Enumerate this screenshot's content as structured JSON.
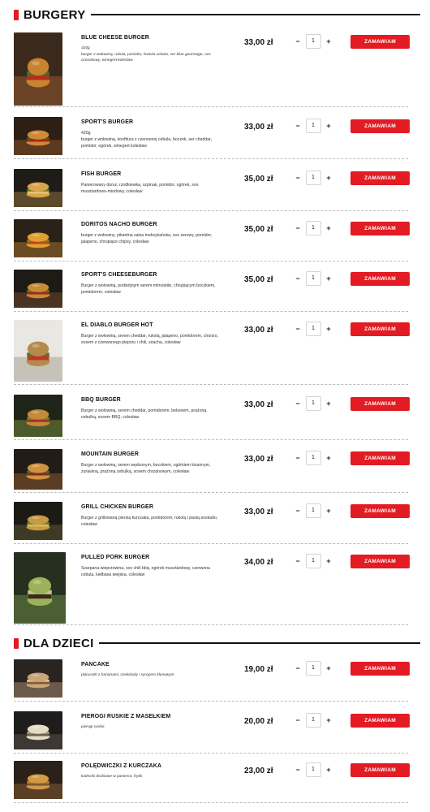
{
  "sections": [
    {
      "title": "BURGERY",
      "items": [
        {
          "name": "BLUE CHEESE BURGER",
          "desc": "420g\nburger z wołowiną, rukola, pomidor, świeża cebula, ser blue gourmage, sos czosnkowy, winegret kolesław",
          "price": "33,00 zł",
          "qty": "1"
        },
        {
          "name": "SPORT'S BURGER",
          "desc": "420g\nburger z wołowiną, konfitura z czerwonej cebula, boczek, ser cheddar, pomidor, ogórek, winegret kolesław",
          "price": "33,00 zł",
          "qty": "1"
        },
        {
          "name": "FISH BURGER",
          "desc": "Panierowany dorsz, rzodkiewka, szpinak, pomidor, ogórek, sos musztardowo-miodowy, colesław",
          "price": "35,00 zł",
          "qty": "1"
        },
        {
          "name": "DORITOS NACHO BURGER",
          "desc": "burger z wołowiny, pikantna salsa meksykańska, sos serowy, pomidor, jalapeno, chrupiące chipsy, colesław",
          "price": "35,00 zł",
          "qty": "1"
        },
        {
          "name": "SPORT'S CHEESEBURGER",
          "desc": "Burger z wołowiną, podwójnym serem mimolette, chrupiącym boczkiem, pomidorem, colesław",
          "price": "35,00 zł",
          "qty": "1"
        },
        {
          "name": "EL DIABLO BURGER HOT",
          "desc": "Burger z wołowiną, serem cheddar, rukolą, jalapeno, pomidorem, chorizo, sosem z czerwonego pieprzu i chili, siracha, colesław",
          "price": "33,00 zł",
          "qty": "1"
        },
        {
          "name": "BBQ BURGER",
          "desc": "Burger z wołowiną, serem cheddar, pomidorem, bekonem, prażoną cebulką, sosem BBQ, colesław",
          "price": "33,00 zł",
          "qty": "1"
        },
        {
          "name": "MOUNTAIN BURGER",
          "desc": "Burger z wołowiną, serem wędzonym, boczkiem, ogórkiem kiszonym, żurawiną, prażoną cebulką, sosem chrzanowym, colesław",
          "price": "33,00 zł",
          "qty": "1"
        },
        {
          "name": "GRILL CHICKEN BURGER",
          "desc": "Burger z grillowaną piersią kurczaka, pomidorem, rukolą i pastą avokado, colesław",
          "price": "33,00 zł",
          "qty": "1"
        },
        {
          "name": "PULLED PORK BURGER",
          "desc": "Szarpana wieprzowina, sos chili bbq, ogórek musztardowy, czerwona cebula, kiełbasa wiejska, colesław",
          "price": "34,00 zł",
          "qty": "1"
        }
      ]
    },
    {
      "title": "DLA DZIECI",
      "items": [
        {
          "name": "PANCAKE",
          "desc": "placuszki z bananami, czekolady i syropem klonowym",
          "price": "19,00 zł",
          "qty": "1"
        },
        {
          "name": "PIEROGI RUSKIE Z MASEŁKIEM",
          "desc": "pierogi ruskie",
          "price": "20,00 zł",
          "qty": "1"
        },
        {
          "name": "POLĘDWICZKI Z KURCZAKA",
          "desc": "kotleciki drobiowe w panierce, frytki",
          "price": "23,00 zł",
          "qty": "1"
        }
      ]
    }
  ],
  "labels": {
    "minus": "−",
    "plus": "+",
    "order": "ZAMAWIAM"
  },
  "colors": {
    "accent": "#e31b23",
    "text": "#111111"
  },
  "icons": {
    "section_marker": "red-bar-marker"
  }
}
